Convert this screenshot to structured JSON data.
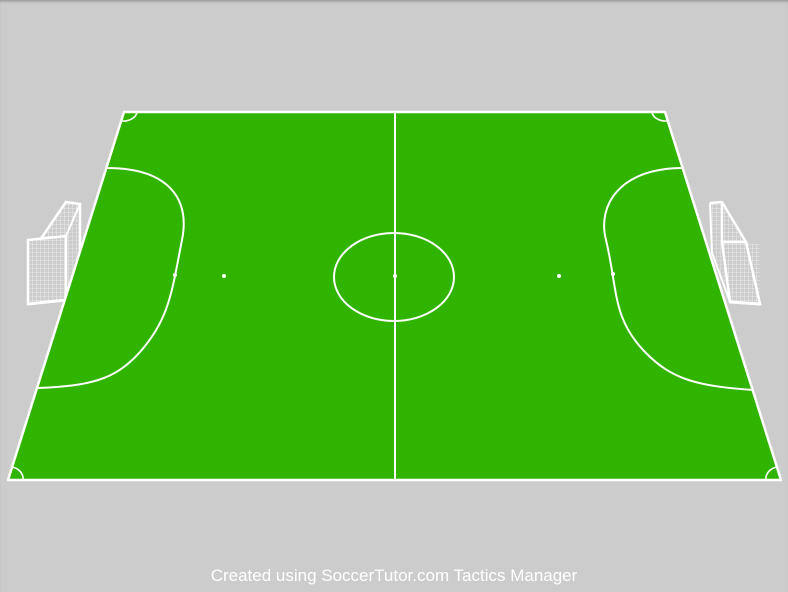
{
  "credit_text": "Created using SoccerTutor.com Tactics Manager",
  "colors": {
    "background": "#cccccc",
    "pitch": "#31b400",
    "lines": "#ffffff"
  },
  "icons": {
    "left_goal": "futsal-goal-icon",
    "right_goal": "futsal-goal-icon"
  }
}
